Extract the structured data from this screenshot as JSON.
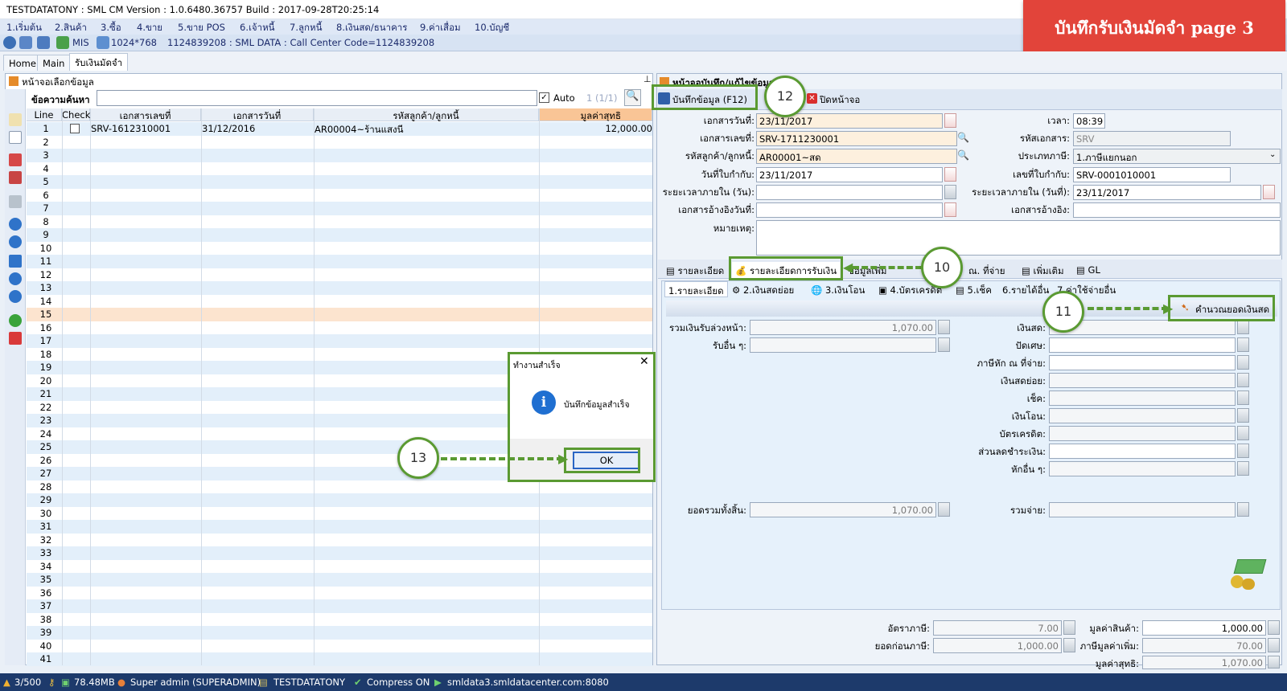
{
  "window": {
    "title": "TESTDATATONY : SML CM Version : 1.0.6480.36757  Build : 2017-09-28T20:25:14"
  },
  "banner": {
    "text": "บันทึกรับเงินมัดจำ page 3"
  },
  "menu": [
    "1.เริ่มต้น",
    "2.สินค้า",
    "3.ซื้อ",
    "4.ขาย",
    "5.ขาย POS",
    "6.เจ้าหนี้",
    "7.ลูกหนี้",
    "8.เงินสด/ธนาคาร",
    "9.ค่าเสื่อม",
    "10.บัญชี"
  ],
  "toolbar": {
    "mis": "MIS",
    "resolution": "1024*768",
    "info": "1124839208 : SML DATA : Call Center Code=1124839208"
  },
  "tabs": [
    "Home",
    "Main",
    "รับเงินมัดจำ"
  ],
  "left": {
    "panel_title": "หน้าจอเลือกข้อมูล",
    "search_label": "ข้อความค้นหา",
    "auto_label": "Auto",
    "page_info": "1 (1/1)",
    "columns": [
      "Line",
      "Check",
      "เอกสารเลขที่",
      "เอกสารวันที่",
      "รหัสลูกค้า/ลูกหนี้",
      "มูลค่าสุทธิ"
    ],
    "row1": {
      "doc_no": "SRV-1612310001",
      "doc_date": "31/12/2016",
      "customer": "AR00004~ร้านแสงนี",
      "net": "12,000.00"
    },
    "line_numbers": [
      "1",
      "2",
      "3",
      "4",
      "5",
      "6",
      "7",
      "8",
      "9",
      "10",
      "11",
      "12",
      "13",
      "14",
      "15",
      "16",
      "17",
      "18",
      "19",
      "20",
      "21",
      "22",
      "23",
      "24",
      "25",
      "26",
      "27",
      "28",
      "29",
      "30",
      "31",
      "32",
      "33",
      "34",
      "35",
      "36",
      "37",
      "38",
      "39",
      "40",
      "41"
    ]
  },
  "right": {
    "panel_title": "หน้าจอบันทึก/แก้ไขข้อมูล",
    "save_button": "บันทึกข้อมูล (F12)",
    "close_button": "ปิดหน้าจอ",
    "fields": {
      "doc_date_label": "เอกสารวันที่:",
      "doc_date": "23/11/2017",
      "time_label": "เวลา:",
      "time": "08:39",
      "doc_no_label": "เอกสารเลขที่:",
      "doc_no": "SRV-1711230001",
      "doc_code_label": "รหัสเอกสาร:",
      "doc_code": "SRV",
      "customer_label": "รหัสลูกค้า/ลูกหนี้:",
      "customer": "AR00001~สด",
      "tax_type_label": "ประเภทภาษี:",
      "tax_type": "1.ภาษีแยกนอก",
      "tax_inv_date_label": "วันที่ใบกำกับ:",
      "tax_inv_date": "23/11/2017",
      "tax_inv_no_label": "เลขที่ใบกำกับ:",
      "tax_inv_no": "SRV-0001010001",
      "period_days_label": "ระยะเวลาภายใน (วัน):",
      "period_days": "",
      "period_date_label": "ระยะเวลาภายใน (วันที่):",
      "period_date": "23/11/2017",
      "ref_date_label": "เอกสารอ้างอิงวันที่:",
      "ref_date": "",
      "ref_doc_label": "เอกสารอ้างอิง:",
      "ref_doc": "",
      "note_label": "หมายเหตุ:"
    },
    "detail_tabs": [
      "รายละเอียด",
      "รายละเอียดการรับเงิน",
      "ข้อมูลเพิ่ม",
      "ณ. ที่จ่าย",
      "เพิ่มเติม",
      "GL"
    ],
    "pay_tabs": [
      "1.รายละเอียด",
      "2.เงินสดย่อย",
      "3.เงินโอน",
      "4.บัตรเครดิต",
      "5.เช็ค",
      "6.รายได้อื่น",
      "7.ค่าใช้จ่ายอื่น"
    ],
    "calc_cash_button": "คำนวณยอดเงินสด",
    "pay": {
      "advance_label": "รวมเงินรับล่วงหน้า:",
      "advance": "1,070.00",
      "other_recv_label": "รับอื่น ๆ:",
      "other_recv": "",
      "cash_label": "เงินสด:",
      "round_label": "ปัดเศษ:",
      "wht_label": "ภาษีหัก ณ ที่จ่าย:",
      "petty_label": "เงินสดย่อย:",
      "cheque_label": "เช็ค:",
      "transfer_label": "เงินโอน:",
      "credit_label": "บัตรเครดิต:",
      "discount_label": "ส่วนลดชำระเงิน:",
      "other_deduct_label": "หักอื่น ๆ:",
      "grand_total_label": "ยอดรวมทั้งสิ้น:",
      "grand_total": "1,070.00",
      "total_pay_label": "รวมจ่าย:"
    },
    "summary": {
      "tax_rate_label": "อัตราภาษี:",
      "tax_rate": "7.00",
      "before_tax_label": "ยอดก่อนภาษี:",
      "before_tax": "1,000.00",
      "goods_value_label": "มูลค่าสินค้า:",
      "goods_value": "1,000.00",
      "vat_label": "ภาษีมูลค่าเพิ่ม:",
      "vat": "70.00",
      "net_label": "มูลค่าสุทธิ:",
      "net": "1,070.00"
    }
  },
  "dialog": {
    "title": "ทำงานสำเร็จ",
    "message": "บันทึกข้อมูลสำเร็จ",
    "ok": "OK"
  },
  "callouts": [
    "10",
    "11",
    "12",
    "13"
  ],
  "status": {
    "count": "3/500",
    "memory": "78.48MB",
    "user": "Super admin (SUPERADMIN)",
    "db": "TESTDATATONY",
    "compress": "Compress ON",
    "server": "smldata3.smldatacenter.com:8080"
  },
  "colors": {
    "accent_green": "#5a9a32",
    "banner_red": "#e2443a",
    "status_bar": "#1d3a6b"
  }
}
